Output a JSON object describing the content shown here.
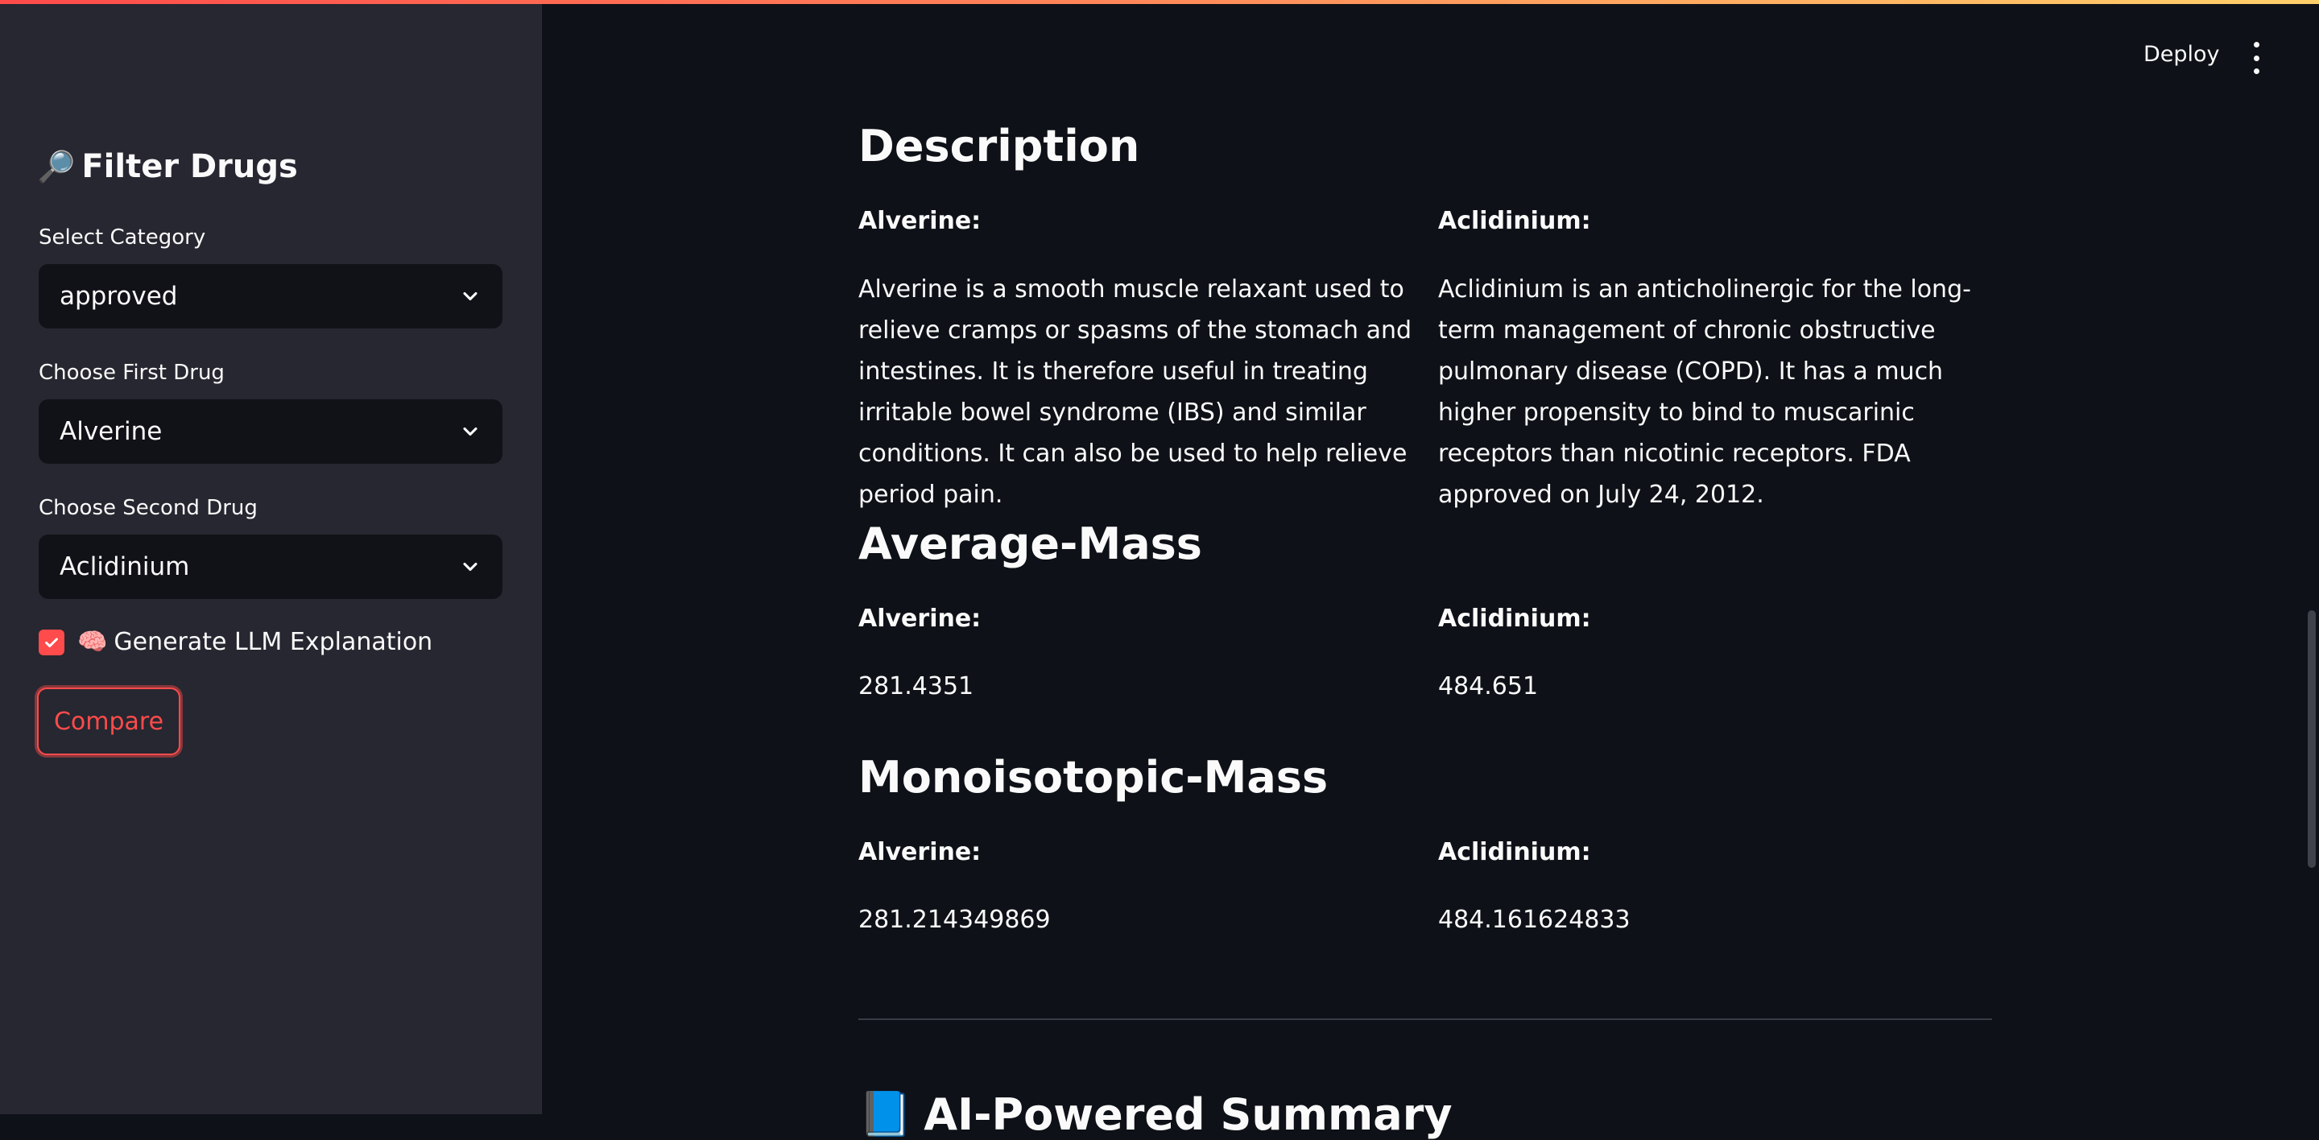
{
  "header": {
    "deploy_label": "Deploy",
    "menu_icon": "kebab-icon"
  },
  "sidebar": {
    "title": "Filter Drugs",
    "title_icon": "🔎",
    "category": {
      "label": "Select Category",
      "value": "approved"
    },
    "first_drug": {
      "label": "Choose First Drug",
      "value": "Alverine"
    },
    "second_drug": {
      "label": "Choose Second Drug",
      "value": "Aclidinium"
    },
    "llm_checkbox": {
      "label": "Generate LLM Explanation",
      "icon": "🧠",
      "checked": true
    },
    "compare_label": "Compare",
    "accent_color": "#ff4b4b"
  },
  "main": {
    "description": {
      "heading": "Description",
      "drug1_label": "Alverine:",
      "drug2_label": "Aclidinium:",
      "drug1_text": "Alverine is a smooth muscle relaxant used to relieve cramps or spasms of the stomach and intestines. It is therefore useful in treating irritable bowel syndrome (IBS) and similar conditions. It can also be used to help relieve period pain.",
      "drug2_text": "Aclidinium is an anticholinergic for the long-term management of chronic obstructive pulmonary disease (COPD). It has a much higher propensity to bind to muscarinic receptors than nicotinic receptors. FDA approved on July 24, 2012."
    },
    "average_mass": {
      "heading": "Average-Mass",
      "drug1_label": "Alverine:",
      "drug2_label": "Aclidinium:",
      "drug1_value": "281.4351",
      "drug2_value": "484.651"
    },
    "monoisotopic_mass": {
      "heading": "Monoisotopic-Mass",
      "drug1_label": "Alverine:",
      "drug2_label": "Aclidinium:",
      "drug1_value": "281.214349869",
      "drug2_value": "484.161624833"
    },
    "summary": {
      "heading": "AI-Powered Summary",
      "icon": "📘"
    }
  }
}
